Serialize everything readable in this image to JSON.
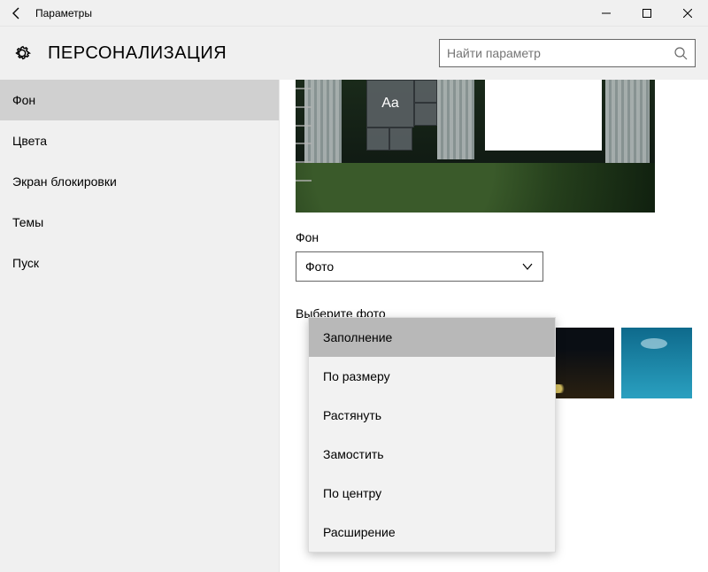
{
  "titlebar": {
    "title": "Параметры"
  },
  "header": {
    "title": "ПЕРСОНАЛИЗАЦИЯ",
    "search_placeholder": "Найти параметр"
  },
  "sidebar": {
    "items": [
      {
        "label": "Фон",
        "active": true
      },
      {
        "label": "Цвета",
        "active": false
      },
      {
        "label": "Экран блокировки",
        "active": false
      },
      {
        "label": "Темы",
        "active": false
      },
      {
        "label": "Пуск",
        "active": false
      }
    ]
  },
  "content": {
    "preview_sample_text": "Aa",
    "bg_label": "Фон",
    "bg_value": "Фото",
    "choose_label": "Выберите фото"
  },
  "fit_popup": {
    "items": [
      {
        "label": "Заполнение",
        "selected": true
      },
      {
        "label": "По размеру",
        "selected": false
      },
      {
        "label": "Растянуть",
        "selected": false
      },
      {
        "label": "Замостить",
        "selected": false
      },
      {
        "label": "По центру",
        "selected": false
      },
      {
        "label": "Расширение",
        "selected": false
      }
    ]
  }
}
